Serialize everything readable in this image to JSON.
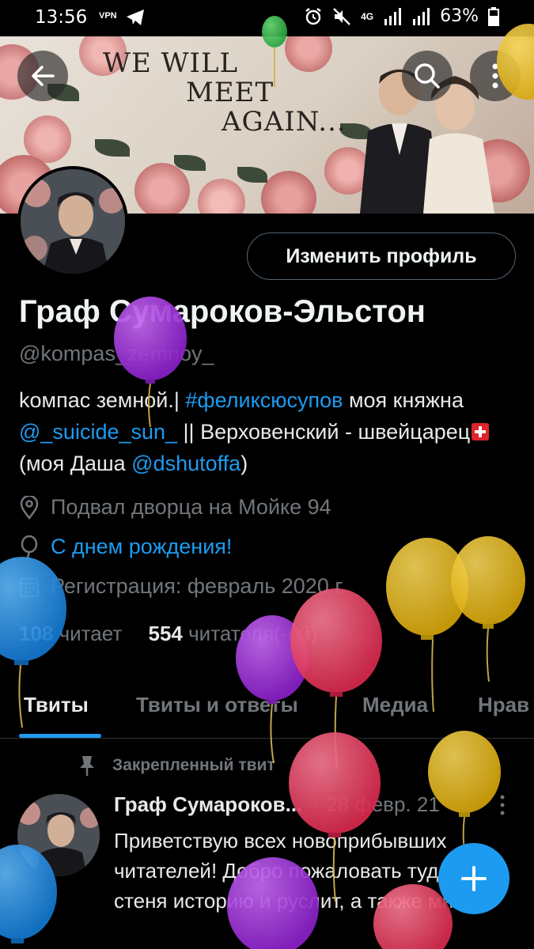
{
  "status_bar": {
    "time": "13:56",
    "vpn": "VPN",
    "network": "4G",
    "battery": "63%"
  },
  "banner": {
    "line1": "WE WILL",
    "line2": "MEET",
    "line3": "AGAIN..."
  },
  "profile": {
    "edit_label": "Изменить профиль",
    "name": "Граф Сумароков-Эльстон",
    "handle": "@kompas_zemnoy_",
    "bio": {
      "p1": "kомпас земной.| ",
      "hashtag": "#феликсюсупов",
      "p2": " моя княжна ",
      "mention1": "@_suicide_sun_",
      "p3": " || Верховенский - швейцарец",
      "p4": " (моя Даша ",
      "mention2": "@dshutoffa",
      "p5": ")"
    },
    "location": "Подвал дворца на Мойке 94",
    "birthday": "С днем рождения!",
    "joined": "Регистрация: февраль 2020 г.",
    "following_count": "108",
    "following_label": "читает",
    "followers_count": "554",
    "followers_label": "читателя(-ей)"
  },
  "tabs": [
    {
      "label": "Твиты"
    },
    {
      "label": "Твиты и ответы"
    },
    {
      "label": "Медиа"
    },
    {
      "label": "Нрав"
    }
  ],
  "pinned_tweet": {
    "pinned_label": "Закрепленный твит",
    "author": "Граф Сумароков...",
    "date": "· 28 февр. 21",
    "text": "Приветствую всех новоприбывших читателей! Добро пожаловать туда, где стеня историю и руслит, а также много"
  },
  "colors": {
    "accent": "#1d9bf0",
    "background": "#000000",
    "secondary_text": "#71767b",
    "balloon_purple": "#9b2fd6",
    "balloon_pink": "#e83a5e",
    "balloon_yellow": "#e6b614",
    "balloon_blue": "#1e8fe0"
  }
}
